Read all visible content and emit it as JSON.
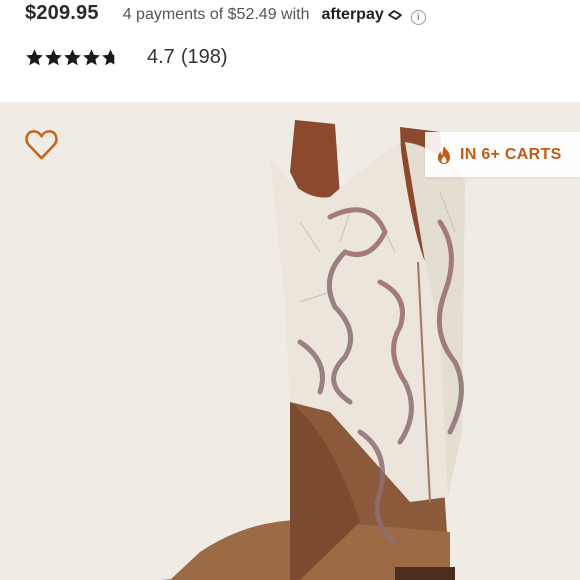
{
  "price": "$209.95",
  "installments": "4 payments of $52.49 with",
  "afterpay": {
    "label": "afterpay",
    "icon": "afterpay-logo-icon"
  },
  "info_icon": "info-icon",
  "rating": {
    "stars": 4.7,
    "max": 5,
    "value": "4.7",
    "count": "(198)"
  },
  "favorite_icon": "heart-outline-icon",
  "badge": {
    "icon": "flame-icon",
    "text": "IN 6+ CARTS",
    "color": "#c45a13"
  },
  "product_image": "western-boot-image",
  "colors": {
    "background": "#f0ebe5",
    "accent": "#c45a13"
  }
}
